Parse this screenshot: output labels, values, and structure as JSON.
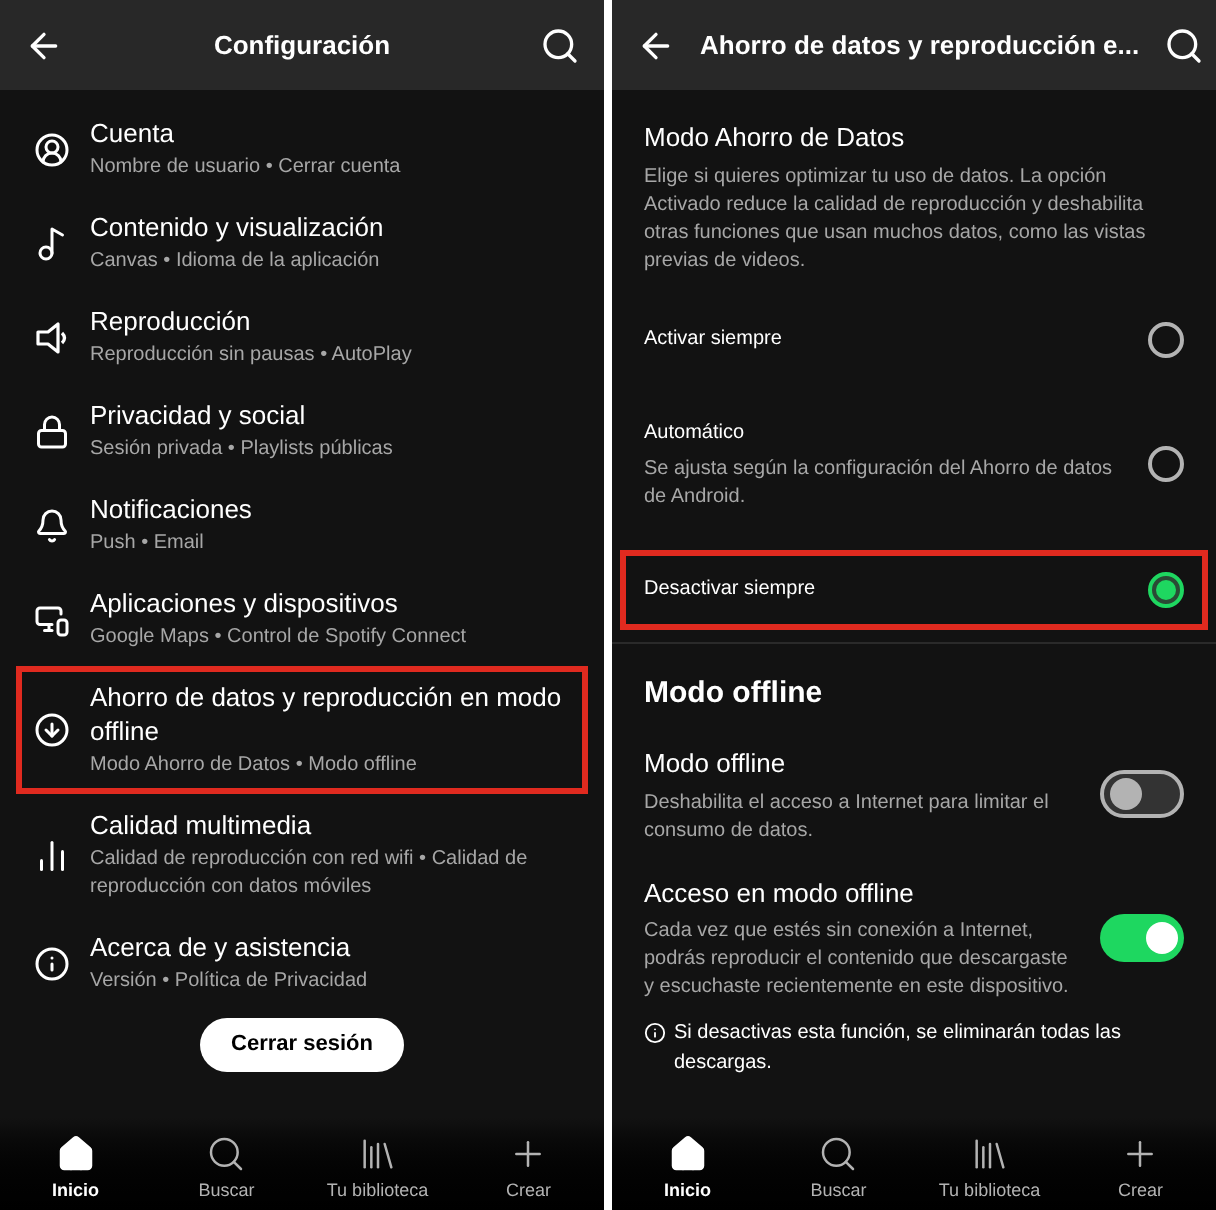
{
  "left_screen": {
    "header": {
      "title": "Configuración"
    },
    "items": [
      {
        "title": "Cuenta",
        "subtitle": "Nombre de usuario • Cerrar cuenta",
        "highlighted": false
      },
      {
        "title": "Contenido y visualización",
        "subtitle": "Canvas • Idioma de la aplicación",
        "highlighted": false
      },
      {
        "title": "Reproducción",
        "subtitle": "Reproducción sin pausas • AutoPlay",
        "highlighted": false
      },
      {
        "title": "Privacidad y social",
        "subtitle": "Sesión privada • Playlists públicas",
        "highlighted": false
      },
      {
        "title": "Notificaciones",
        "subtitle": "Push • Email",
        "highlighted": false
      },
      {
        "title": "Aplicaciones y dispositivos",
        "subtitle": "Google Maps • Control de Spotify Connect",
        "highlighted": false
      },
      {
        "title": "Ahorro de datos y reproducción en modo offline",
        "subtitle": "Modo Ahorro de Datos • Modo offline",
        "highlighted": true
      },
      {
        "title": "Calidad multimedia",
        "subtitle": "Calidad de reproducción con red wifi • Calidad de reproducción con datos móviles",
        "highlighted": false
      },
      {
        "title": "Acerca de y asistencia",
        "subtitle": "Versión • Política de Privacidad",
        "highlighted": false
      }
    ],
    "logout_button": "Cerrar sesión",
    "nav": [
      {
        "label": "Inicio",
        "selected": true
      },
      {
        "label": "Buscar",
        "selected": false
      },
      {
        "label": "Tu biblioteca",
        "selected": false
      },
      {
        "label": "Crear",
        "selected": false
      }
    ]
  },
  "right_screen": {
    "header": {
      "title": "Ahorro de datos y reproducción e..."
    },
    "data_saver": {
      "title": "Modo Ahorro de Datos",
      "description": "Elige si quieres optimizar tu uso de datos. La opción Activado reduce la calidad de reproducción y deshabilita otras funciones que usan muchos datos, como las vistas previas de videos.",
      "options": [
        {
          "label": "Activar siempre",
          "selected": false,
          "highlighted": false
        },
        {
          "label": "Automático",
          "description": "Se ajusta según la configuración del Ahorro de datos de Android.",
          "selected": false,
          "highlighted": false
        },
        {
          "label": "Desactivar siempre",
          "selected": true,
          "highlighted": true
        }
      ]
    },
    "offline": {
      "heading": "Modo offline",
      "settings": [
        {
          "title": "Modo offline",
          "description": "Deshabilita el acceso a Internet para limitar el consumo de datos.",
          "on": false
        },
        {
          "title": "Acceso en modo offline",
          "description": "Cada vez que estés sin conexión a Internet, podrás reproducir el contenido que descargaste y escuchaste recientemente en este dispositivo.",
          "on": true
        }
      ],
      "note": "Si desactivas esta función, se eliminarán todas las descargas."
    },
    "nav": [
      {
        "label": "Inicio",
        "selected": true
      },
      {
        "label": "Buscar",
        "selected": false
      },
      {
        "label": "Tu biblioteca",
        "selected": false
      },
      {
        "label": "Crear",
        "selected": false
      }
    ]
  }
}
